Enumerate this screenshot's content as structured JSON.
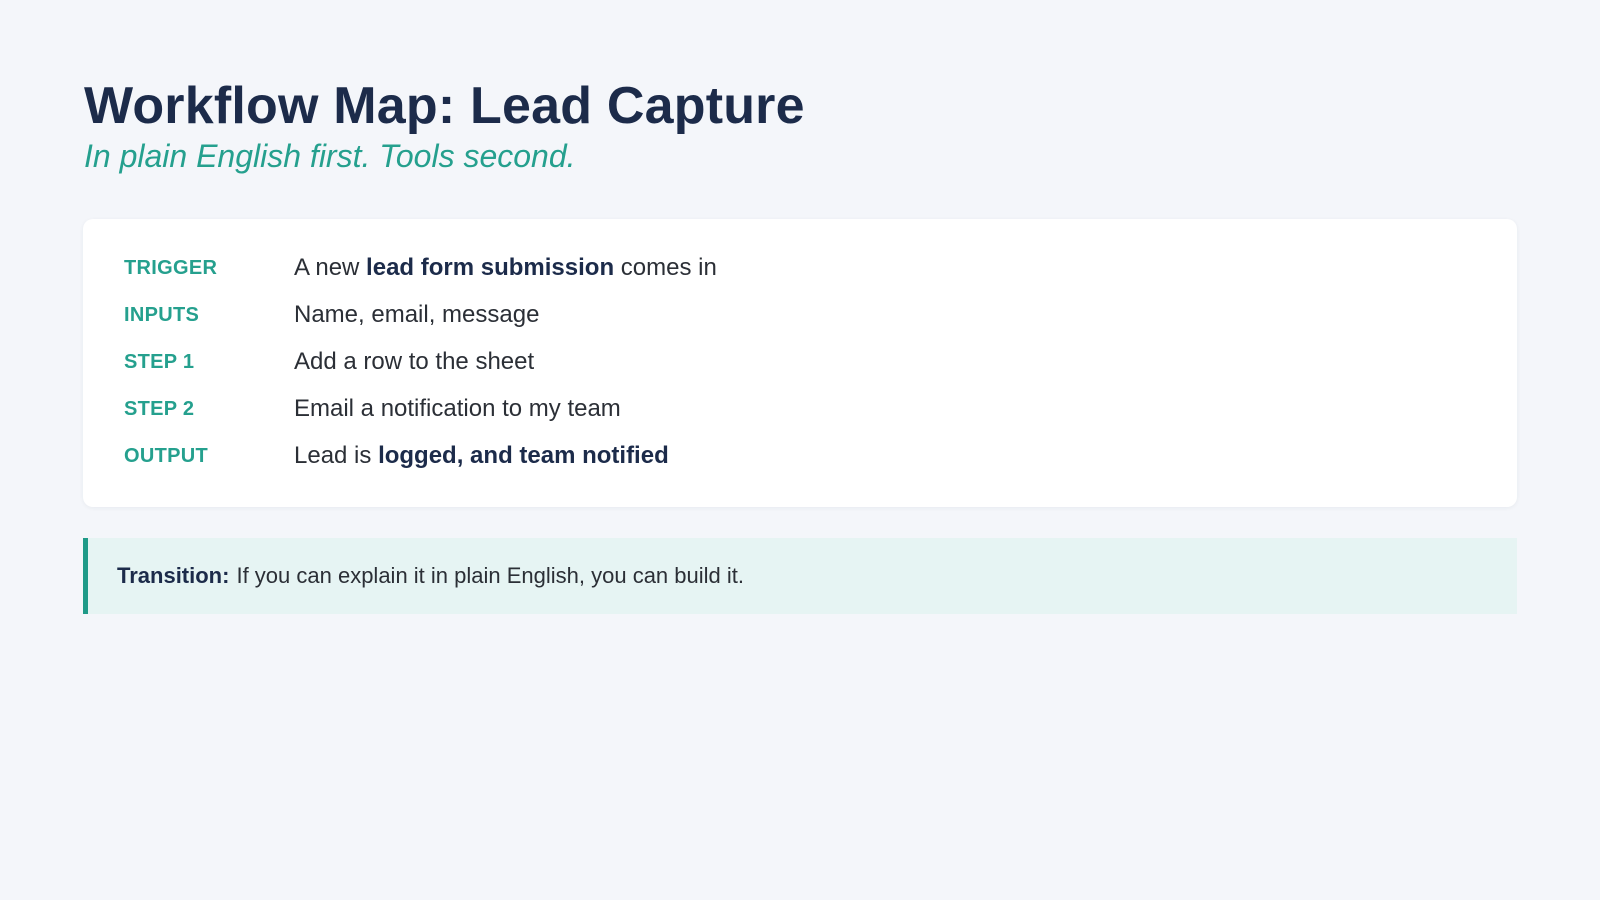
{
  "header": {
    "title": "Workflow Map: Lead Capture",
    "subtitle": "In plain English first. Tools second."
  },
  "workflow": {
    "rows": [
      {
        "label": "TRIGGER",
        "pre": "A new ",
        "bold": "lead form submission",
        "post": " comes in"
      },
      {
        "label": "INPUTS",
        "pre": "Name, email, message",
        "bold": "",
        "post": ""
      },
      {
        "label": "STEP 1",
        "pre": "Add a row to the sheet",
        "bold": "",
        "post": ""
      },
      {
        "label": "STEP 2",
        "pre": "Email a notification to my team",
        "bold": "",
        "post": ""
      },
      {
        "label": "OUTPUT",
        "pre": "Lead is ",
        "bold": "logged, and team notified",
        "post": ""
      }
    ]
  },
  "callout": {
    "label": "Transition:",
    "text": "If you can explain it in plain English, you can build it."
  },
  "colors": {
    "background": "#f4f6fa",
    "title": "#1c2b4a",
    "accent": "#25a08e",
    "callout_bg": "#e6f4f3"
  }
}
